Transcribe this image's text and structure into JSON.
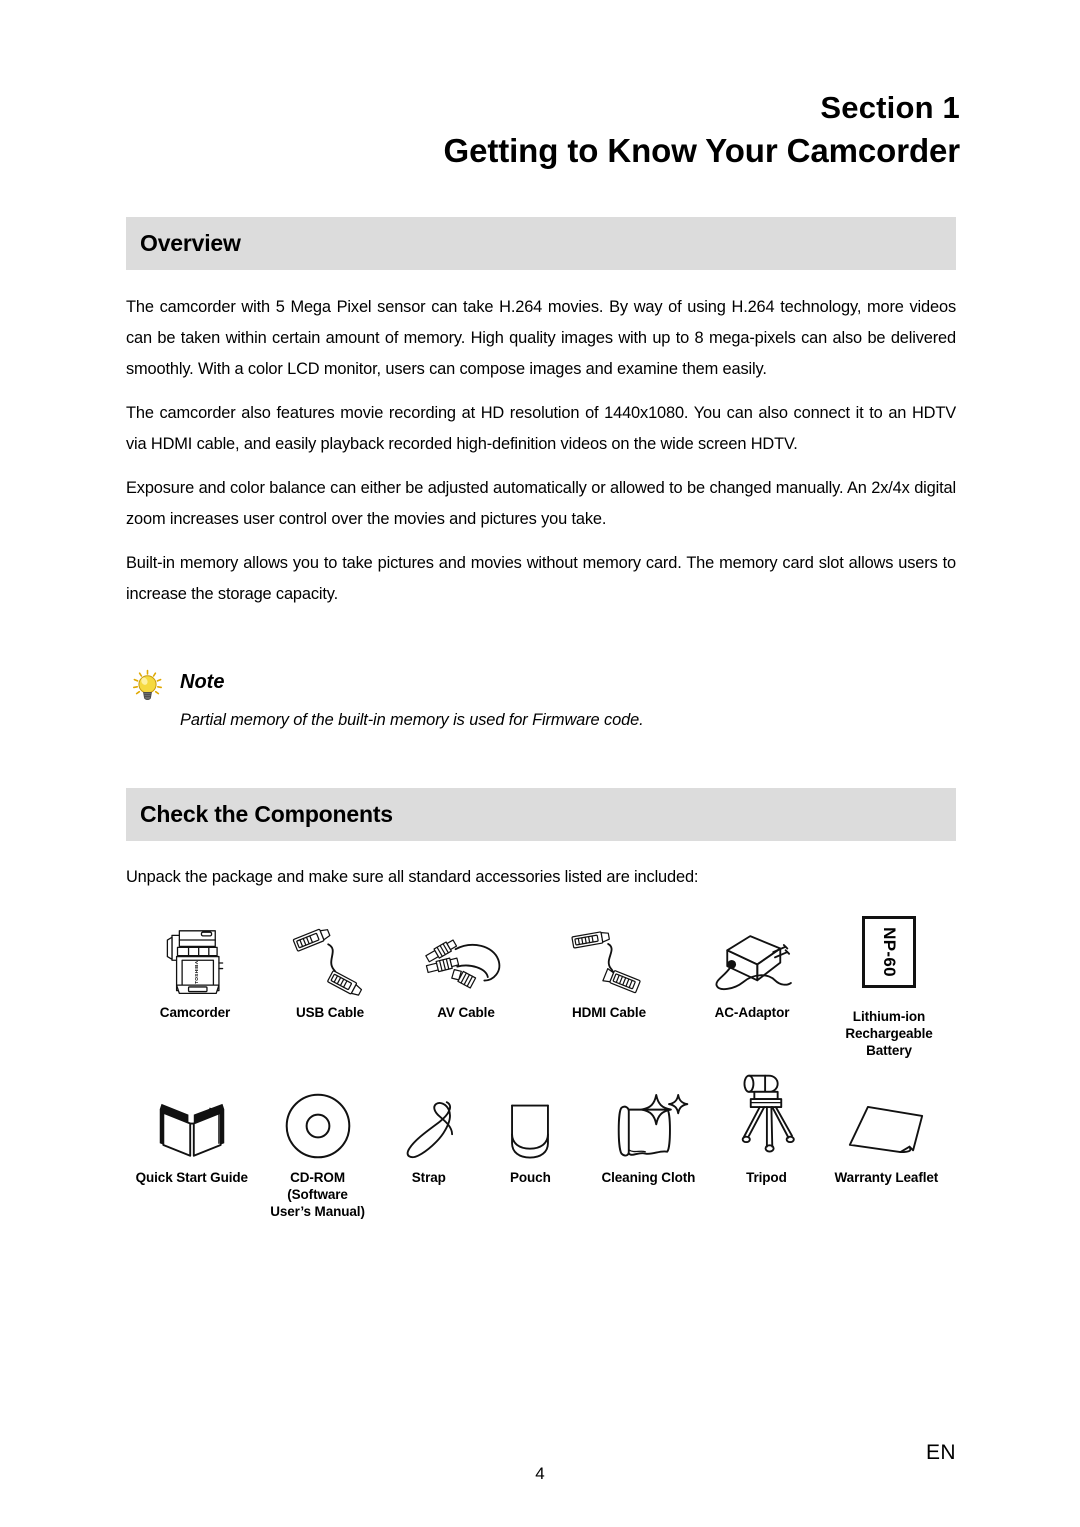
{
  "document": {
    "section_label": "Section 1",
    "section_title": "Getting to Know Your Camcorder"
  },
  "overview": {
    "heading": "Overview",
    "paragraphs": [
      "The camcorder with 5 Mega Pixel sensor can take H.264 movies. By way of using H.264 technology, more videos can be taken within certain amount of memory. High quality images with up to 8 mega-pixels can also be delivered smoothly. With a color LCD monitor, users can compose images and examine them easily.",
      "The camcorder also features  movie recording at HD resolution of 1440x1080. You can also connect it to an HDTV via HDMI cable, and easily playback recorded high-definition videos on the wide screen HDTV.",
      "Exposure and color balance can either be adjusted automatically or allowed to be changed manually. An 2x/4x digital zoom increases user control over the movies and pictures you take.",
      "Built-in memory allows you to take pictures and movies without memory card. The memory card slot allows users to increase the storage capacity."
    ]
  },
  "note": {
    "icon": "lightbulb-icon",
    "title": "Note",
    "text": "Partial memory of the built-in memory is used for Firmware code."
  },
  "components": {
    "heading": "Check the Components",
    "intro": "Unpack the package and make sure all standard accessories listed are included:",
    "row1": [
      {
        "icon": "camcorder-icon",
        "label": "Camcorder",
        "brand": "TOSHIBA"
      },
      {
        "icon": "usb-cable-icon",
        "label": "USB Cable"
      },
      {
        "icon": "av-cable-icon",
        "label": "AV Cable"
      },
      {
        "icon": "hdmi-cable-icon",
        "label": "HDMI Cable"
      },
      {
        "icon": "ac-adaptor-icon",
        "label": "AC-Adaptor"
      },
      {
        "icon": "battery-icon",
        "label": "Lithium-ion\nRechargeable\nBattery",
        "model": "NP-60"
      }
    ],
    "row2": [
      {
        "icon": "quick-start-guide-icon",
        "label": "Quick Start Guide"
      },
      {
        "icon": "cd-rom-icon",
        "label": "CD-ROM\n(Software\nUser’s Manual)"
      },
      {
        "icon": "strap-icon",
        "label": "Strap"
      },
      {
        "icon": "pouch-icon",
        "label": "Pouch"
      },
      {
        "icon": "cleaning-cloth-icon",
        "label": "Cleaning Cloth"
      },
      {
        "icon": "tripod-icon",
        "label": "Tripod"
      },
      {
        "icon": "warranty-leaflet-icon",
        "label": "Warranty Leaflet"
      }
    ]
  },
  "footer": {
    "language": "EN",
    "page_number": "4"
  },
  "colors": {
    "header_bar": "#dcdcdc",
    "text": "#000000",
    "bulb_yellow": "#f5d940"
  }
}
